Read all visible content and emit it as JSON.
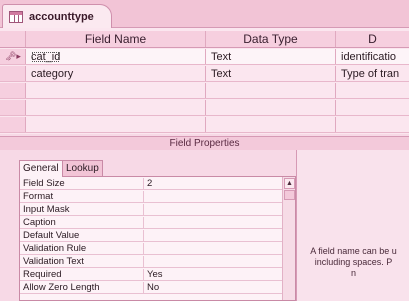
{
  "document_tab": {
    "label": "accounttype"
  },
  "columns": {
    "field_name": "Field Name",
    "data_type": "Data Type",
    "description": "D"
  },
  "fields": [
    {
      "name": "cat_id",
      "type": "Text",
      "description": "identificatio"
    },
    {
      "name": "category",
      "type": "Text",
      "description": "Type of tran"
    }
  ],
  "field_properties_title": "Field Properties",
  "property_tabs": {
    "general": "General",
    "lookup": "Lookup"
  },
  "properties": [
    {
      "label": "Field Size",
      "value": "2"
    },
    {
      "label": "Format",
      "value": ""
    },
    {
      "label": "Input Mask",
      "value": ""
    },
    {
      "label": "Caption",
      "value": ""
    },
    {
      "label": "Default Value",
      "value": ""
    },
    {
      "label": "Validation Rule",
      "value": ""
    },
    {
      "label": "Validation Text",
      "value": ""
    },
    {
      "label": "Required",
      "value": "Yes"
    },
    {
      "label": "Allow Zero Length",
      "value": "No"
    }
  ],
  "help": {
    "line1": "A field name can be u",
    "line2": "including spaces.  P",
    "line3": "n"
  },
  "icons": {
    "tab": "table-icon",
    "key": "primary-key-icon",
    "scroll_up": "chevron-up-icon"
  },
  "colors": {
    "accent": "#f2c4d6",
    "grid_bg": "#fbe6ef"
  }
}
